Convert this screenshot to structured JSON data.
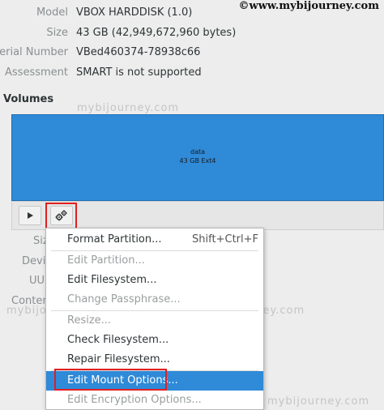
{
  "watermark": {
    "top": "©www.mybijourney.com",
    "faint": "mybijourney.com"
  },
  "disk_info": [
    {
      "label": "Model",
      "value": "VBOX HARDDISK (1.0)"
    },
    {
      "label": "Size",
      "value": "43 GB (42,949,672,960 bytes)"
    },
    {
      "label": "Serial Number",
      "value": "VBed460374-78938c66"
    },
    {
      "label": "Assessment",
      "value": "SMART is not supported"
    }
  ],
  "volumes": {
    "title": "Volumes",
    "partition": {
      "name": "data",
      "info": "43 GB Ext4"
    },
    "color": "#2f8ad8"
  },
  "side_labels": [
    "Siz",
    "Devic",
    "UUI",
    "Conten"
  ],
  "toolbar": {
    "play_icon": "play-icon",
    "gear_icon": "gears-icon"
  },
  "context_menu": {
    "items": [
      {
        "label": "Format Partition...",
        "shortcut": "Shift+Ctrl+F",
        "disabled": false,
        "selected": false
      },
      {
        "label": "Edit Partition...",
        "shortcut": "",
        "disabled": true,
        "selected": false
      },
      {
        "label": "Edit Filesystem...",
        "shortcut": "",
        "disabled": false,
        "selected": false
      },
      {
        "label": "Change Passphrase...",
        "shortcut": "",
        "disabled": true,
        "selected": false
      },
      {
        "label": "Resize...",
        "shortcut": "",
        "disabled": true,
        "selected": false
      },
      {
        "label": "Check Filesystem...",
        "shortcut": "",
        "disabled": false,
        "selected": false
      },
      {
        "label": "Repair Filesystem...",
        "shortcut": "",
        "disabled": false,
        "selected": false
      },
      {
        "label": "Edit Mount Options...",
        "shortcut": "",
        "disabled": false,
        "selected": true
      },
      {
        "label": "Edit Encryption Options...",
        "shortcut": "",
        "disabled": true,
        "selected": false
      }
    ]
  },
  "highlight_color": "#e02020"
}
